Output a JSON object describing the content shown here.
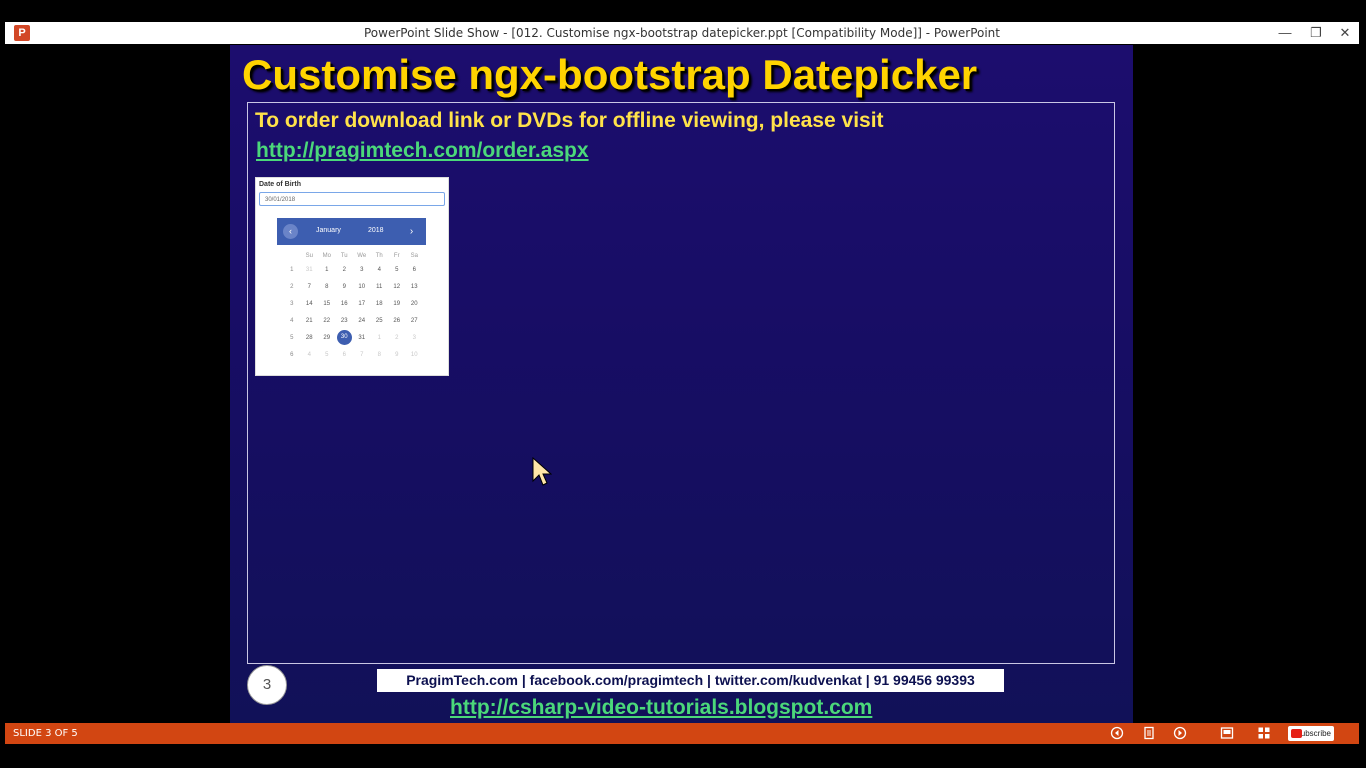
{
  "window": {
    "title": "PowerPoint Slide Show - [012. Customise ngx-bootstrap datepicker.ppt [Compatibility Mode]] - PowerPoint",
    "app_icon": "P",
    "minimize": "—",
    "restore": "❐",
    "close": "✕"
  },
  "slide": {
    "title": "Customise ngx-bootstrap Datepicker",
    "order_text": "To order download link or DVDs for offline viewing, please visit",
    "order_link": "http://pragimtech.com/order.aspx",
    "number": "3",
    "contact": "PragimTech.com | facebook.com/pragimtech  | twitter.com/kudvenkat  | 91 99456 99393",
    "blog_link": "http://csharp-video-tutorials.blogspot.com",
    "datepicker": {
      "label": "Date of Birth",
      "input_value": "30/01/2018",
      "month": "January",
      "year": "2018",
      "weekdays": [
        "Su",
        "Mo",
        "Tu",
        "We",
        "Th",
        "Fr",
        "Sa"
      ],
      "weeks": [
        {
          "week": "1",
          "days": [
            "31",
            "1",
            "2",
            "3",
            "4",
            "5",
            "6"
          ]
        },
        {
          "week": "2",
          "days": [
            "7",
            "8",
            "9",
            "10",
            "11",
            "12",
            "13"
          ]
        },
        {
          "week": "3",
          "days": [
            "14",
            "15",
            "16",
            "17",
            "18",
            "19",
            "20"
          ]
        },
        {
          "week": "4",
          "days": [
            "21",
            "22",
            "23",
            "24",
            "25",
            "26",
            "27"
          ]
        },
        {
          "week": "5",
          "days": [
            "28",
            "29",
            "30",
            "31",
            "1",
            "2",
            "3"
          ]
        },
        {
          "week": "6",
          "days": [
            "4",
            "5",
            "6",
            "7",
            "8",
            "9",
            "10"
          ]
        }
      ],
      "selected": "30"
    }
  },
  "statusbar": {
    "slide_count": "SLIDE 3 OF 5",
    "subscribe": "Subscribe"
  },
  "colors": {
    "title_yellow": "#ffd400",
    "link_green": "#4bd87a",
    "statusbar_orange": "#d24612",
    "slide_bg": "#1c0d6e"
  }
}
